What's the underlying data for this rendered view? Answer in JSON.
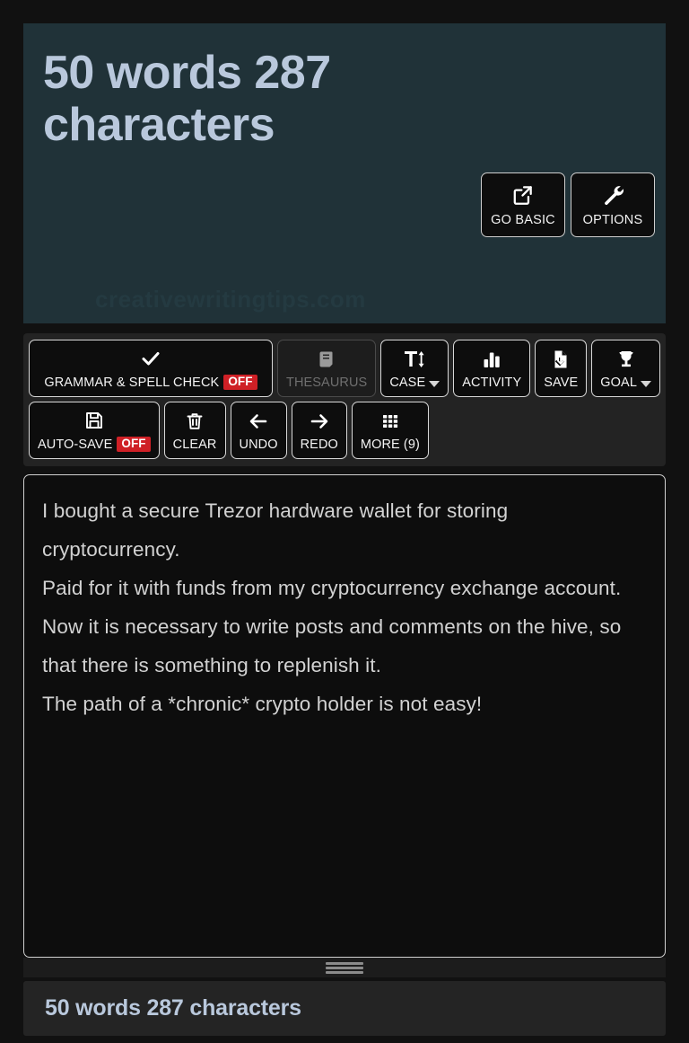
{
  "header": {
    "count_text": "50 words 287 characters",
    "watermark": "creativewritingtips.com",
    "buttons": [
      {
        "label": "GO BASIC",
        "icon": "external-link-icon"
      },
      {
        "label": "OPTIONS",
        "icon": "wrench-icon"
      }
    ]
  },
  "toolbar": {
    "row1": [
      {
        "label": "GRAMMAR & SPELL CHECK",
        "badge": "OFF",
        "icon": "checkmark-icon",
        "disabled": false,
        "caret": false
      },
      {
        "label": "THESAURUS",
        "badge": "",
        "icon": "book-icon",
        "disabled": true,
        "caret": false
      },
      {
        "label": "CASE",
        "badge": "",
        "icon": "text-case-icon",
        "disabled": false,
        "caret": true
      },
      {
        "label": "ACTIVITY",
        "badge": "",
        "icon": "bar-chart-icon",
        "disabled": false,
        "caret": false
      },
      {
        "label": "SAVE",
        "badge": "",
        "icon": "file-download-icon",
        "disabled": false,
        "caret": false
      },
      {
        "label": "GOAL",
        "badge": "",
        "icon": "trophy-icon",
        "disabled": false,
        "caret": true
      }
    ],
    "row2": [
      {
        "label": "AUTO-SAVE",
        "badge": "OFF",
        "icon": "floppy-disk-icon",
        "disabled": false,
        "caret": false
      },
      {
        "label": "CLEAR",
        "badge": "",
        "icon": "trash-icon",
        "disabled": false,
        "caret": false
      },
      {
        "label": "UNDO",
        "badge": "",
        "icon": "arrow-left-icon",
        "disabled": false,
        "caret": false
      },
      {
        "label": "REDO",
        "badge": "",
        "icon": "arrow-right-icon",
        "disabled": false,
        "caret": false
      },
      {
        "label": "MORE (9)",
        "badge": "",
        "icon": "grid-icon",
        "disabled": false,
        "caret": false
      }
    ]
  },
  "editor": {
    "content": "I bought a secure Trezor hardware wallet for storing cryptocurrency.\nPaid for it with funds from my cryptocurrency exchange account.\nNow it is necessary to write posts and comments on the hive, so that there is something to replenish it.\nThe path of a *chronic* crypto holder is not easy!"
  },
  "footer": {
    "count_text": "50 words 287 characters"
  },
  "colors": {
    "header_bg": "#203238",
    "accent_text": "#b9c8dc",
    "badge_off": "#cf2026",
    "button_bg": "#0d0d0d",
    "toolbar_bg": "#232323"
  }
}
